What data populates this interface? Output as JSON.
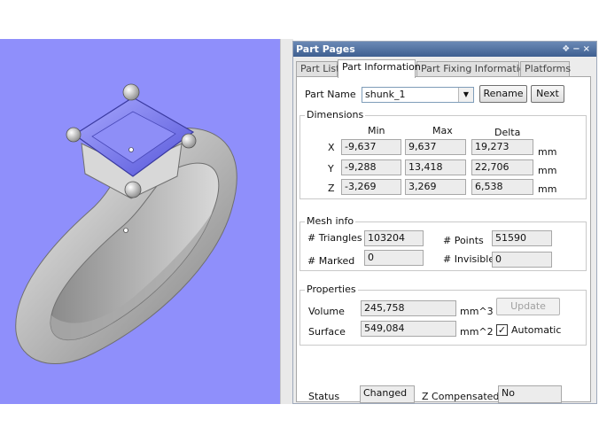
{
  "panel": {
    "title": "Part Pages",
    "title_buttons": "❖−×"
  },
  "tabs": [
    {
      "label": "Part List"
    },
    {
      "label": "Part Information"
    },
    {
      "label": "Part Fixing Information"
    },
    {
      "label": "Platforms"
    }
  ],
  "part_name": {
    "label": "Part Name",
    "value": "shunk_1",
    "rename_label": "Rename",
    "next_label": "Next"
  },
  "dimensions": {
    "title": "Dimensions",
    "headers": [
      "Min",
      "Max",
      "Delta"
    ],
    "unit": "mm",
    "rows": [
      {
        "axis": "X",
        "min": "-9,637",
        "max": "9,637",
        "delta": "19,273"
      },
      {
        "axis": "Y",
        "min": "-9,288",
        "max": "13,418",
        "delta": "22,706"
      },
      {
        "axis": "Z",
        "min": "-3,269",
        "max": "3,269",
        "delta": "6,538"
      }
    ]
  },
  "mesh": {
    "title": "Mesh info",
    "triangles_label": "# Triangles",
    "triangles": "103204",
    "points_label": "# Points",
    "points": "51590",
    "marked_label": "# Marked",
    "marked": "0",
    "invisible_label": "# Invisible",
    "invisible": "0"
  },
  "properties": {
    "title": "Properties",
    "volume_label": "Volume",
    "volume": "245,758",
    "volume_unit": "mm^3",
    "surface_label": "Surface",
    "surface": "549,084",
    "surface_unit": "mm^2",
    "update_label": "Update",
    "automatic_label": "Automatic",
    "automatic_checked": "✓"
  },
  "status": {
    "label": "Status",
    "value": "Changed",
    "zcomp_label": "Z Compensated",
    "zcomp_value": "No"
  },
  "colors": {
    "viewport_bg": "#8f8ffb",
    "ring": "#c8c8c8",
    "gem": "#7d7df0"
  }
}
